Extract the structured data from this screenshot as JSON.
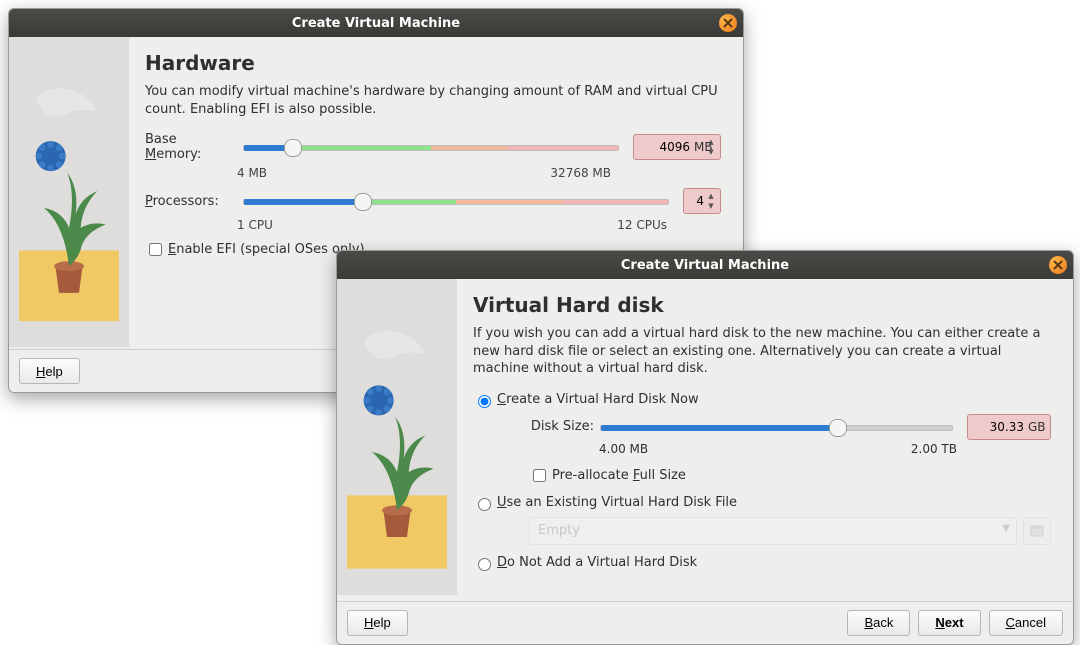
{
  "dialog1": {
    "title": "Create Virtual Machine",
    "heading": "Hardware",
    "description": "You can modify virtual machine's hardware by changing amount of RAM and virtual CPU count. Enabling EFI is also possible.",
    "memory": {
      "label_pre": "Base ",
      "label_ul": "M",
      "label_post": "emory:",
      "scale_min": "4 MB",
      "scale_max": "32768 MB",
      "value": "4096",
      "unit": "MB",
      "fill_pct": 13,
      "zone_g_end": 50,
      "zone_o_end": 70
    },
    "cpu": {
      "label_ul": "P",
      "label_post": "rocessors:",
      "scale_min": "1 CPU",
      "scale_max": "12 CPUs",
      "value": "4",
      "fill_pct": 28,
      "zone_g_end": 50,
      "zone_o_end": 75
    },
    "efi": {
      "label_ul": "E",
      "label_post": "nable EFI (special OSes only)",
      "checked": false
    },
    "buttons": {
      "help_ul": "H",
      "help_post": "elp"
    }
  },
  "dialog2": {
    "title": "Create Virtual Machine",
    "heading": "Virtual Hard disk",
    "description": "If you wish you can add a virtual hard disk to the new machine. You can either create a new hard disk file or select an existing one. Alternatively you can create a virtual machine without a virtual hard disk.",
    "option1": {
      "label_ul": "C",
      "label_post": "reate a Virtual Hard Disk Now",
      "selected": true
    },
    "disk": {
      "label_pre": "D",
      "label_ul": "i",
      "label_post": "sk Size:",
      "scale_min": "4.00 MB",
      "scale_max": "2.00 TB",
      "value": "30.33",
      "unit": "GB",
      "fill_pct": 67
    },
    "prealloc": {
      "label_pre": "Pre-allocate ",
      "label_ul": "F",
      "label_post": "ull Size",
      "checked": false
    },
    "option2": {
      "label_ul": "U",
      "label_post": "se an Existing Virtual Hard Disk File",
      "selected": false
    },
    "combo_value": "Empty",
    "option3": {
      "label_ul": "D",
      "label_post": "o Not Add a Virtual Hard Disk",
      "selected": false
    },
    "buttons": {
      "help_ul": "H",
      "help_post": "elp",
      "back_ul": "B",
      "back_post": "ack",
      "next_ul": "N",
      "next_post": "ext",
      "cancel_ul": "C",
      "cancel_post": "ancel"
    }
  }
}
